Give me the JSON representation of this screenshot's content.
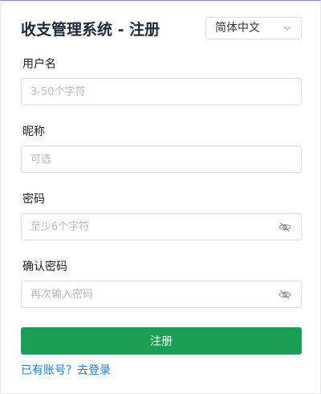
{
  "header": {
    "title": "收支管理系统 - 注册",
    "language_selected": "简体中文",
    "chevron_icon": "chevron-down-icon"
  },
  "form": {
    "username": {
      "label": "用户名",
      "placeholder": "3-50个字符",
      "value": ""
    },
    "nickname": {
      "label": "昵称",
      "placeholder": "可选",
      "value": ""
    },
    "password": {
      "label": "密码",
      "placeholder": "至少6个字符",
      "value": "",
      "toggle_icon": "eye-slash-icon"
    },
    "confirm_password": {
      "label": "确认密码",
      "placeholder": "再次输入密码",
      "value": "",
      "toggle_icon": "eye-slash-icon"
    },
    "submit_label": "注册"
  },
  "footer": {
    "login_link": "已有账号？去登录"
  },
  "colors": {
    "primary_button": "#1a9f55",
    "link": "#1d7fd6",
    "border": "#d9d9d9"
  }
}
